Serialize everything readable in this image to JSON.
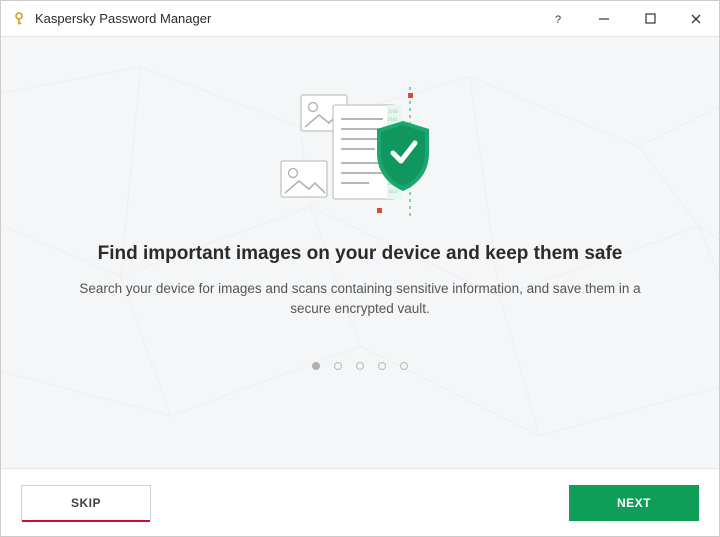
{
  "window": {
    "title": "Kaspersky Password Manager"
  },
  "onboarding": {
    "headline": "Find important images on your device and keep them safe",
    "subtext": "Search your device for images and scans containing sensitive information, and save them in a secure encrypted vault.",
    "page_count": 5,
    "current_page": 1
  },
  "footer": {
    "skip_label": "Skip",
    "next_label": "Next"
  },
  "colors": {
    "accent_green": "#0f9d58",
    "brand_red": "#c8102e"
  }
}
